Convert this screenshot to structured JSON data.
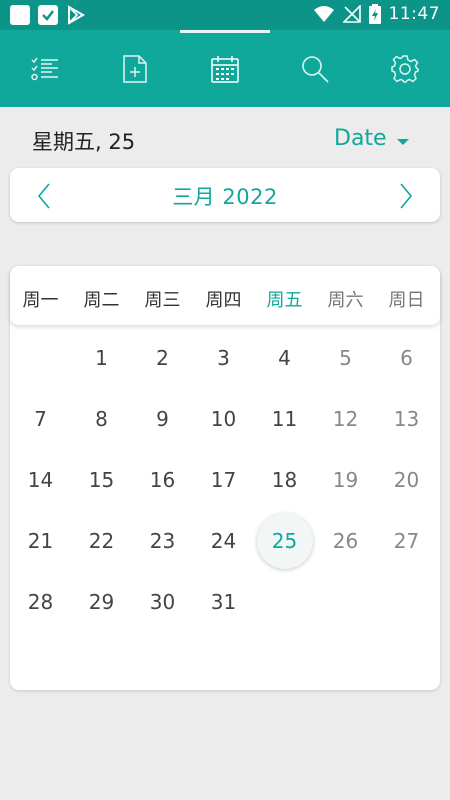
{
  "status_bar": {
    "time": "11:47",
    "icons": [
      "app-square-icon",
      "checkbox-icon",
      "play-store-icon",
      "wifi-icon",
      "no-signal-icon",
      "battery-charging-icon"
    ]
  },
  "toolbar": {
    "items": [
      {
        "name": "task-list-icon"
      },
      {
        "name": "add-note-icon"
      },
      {
        "name": "calendar-icon",
        "active": true
      },
      {
        "name": "search-icon"
      },
      {
        "name": "settings-icon"
      }
    ]
  },
  "header": {
    "date_label": "星期五, 25",
    "sort_label": "Date"
  },
  "month_nav": {
    "label": "三月 2022"
  },
  "calendar": {
    "weekdays": [
      "周一",
      "周二",
      "周三",
      "周四",
      "周五",
      "周六",
      "周日"
    ],
    "selected_weekday_index": 4,
    "weeks": [
      [
        "",
        "1",
        "2",
        "3",
        "4",
        "5",
        "6"
      ],
      [
        "7",
        "8",
        "9",
        "10",
        "11",
        "12",
        "13"
      ],
      [
        "14",
        "15",
        "16",
        "17",
        "18",
        "19",
        "20"
      ],
      [
        "21",
        "22",
        "23",
        "24",
        "25",
        "26",
        "27"
      ],
      [
        "28",
        "29",
        "30",
        "31",
        "",
        "",
        ""
      ]
    ],
    "today": "25"
  },
  "colors": {
    "accent": "#0fa89a",
    "status_bar": "#0d9488",
    "background": "#ececec"
  }
}
